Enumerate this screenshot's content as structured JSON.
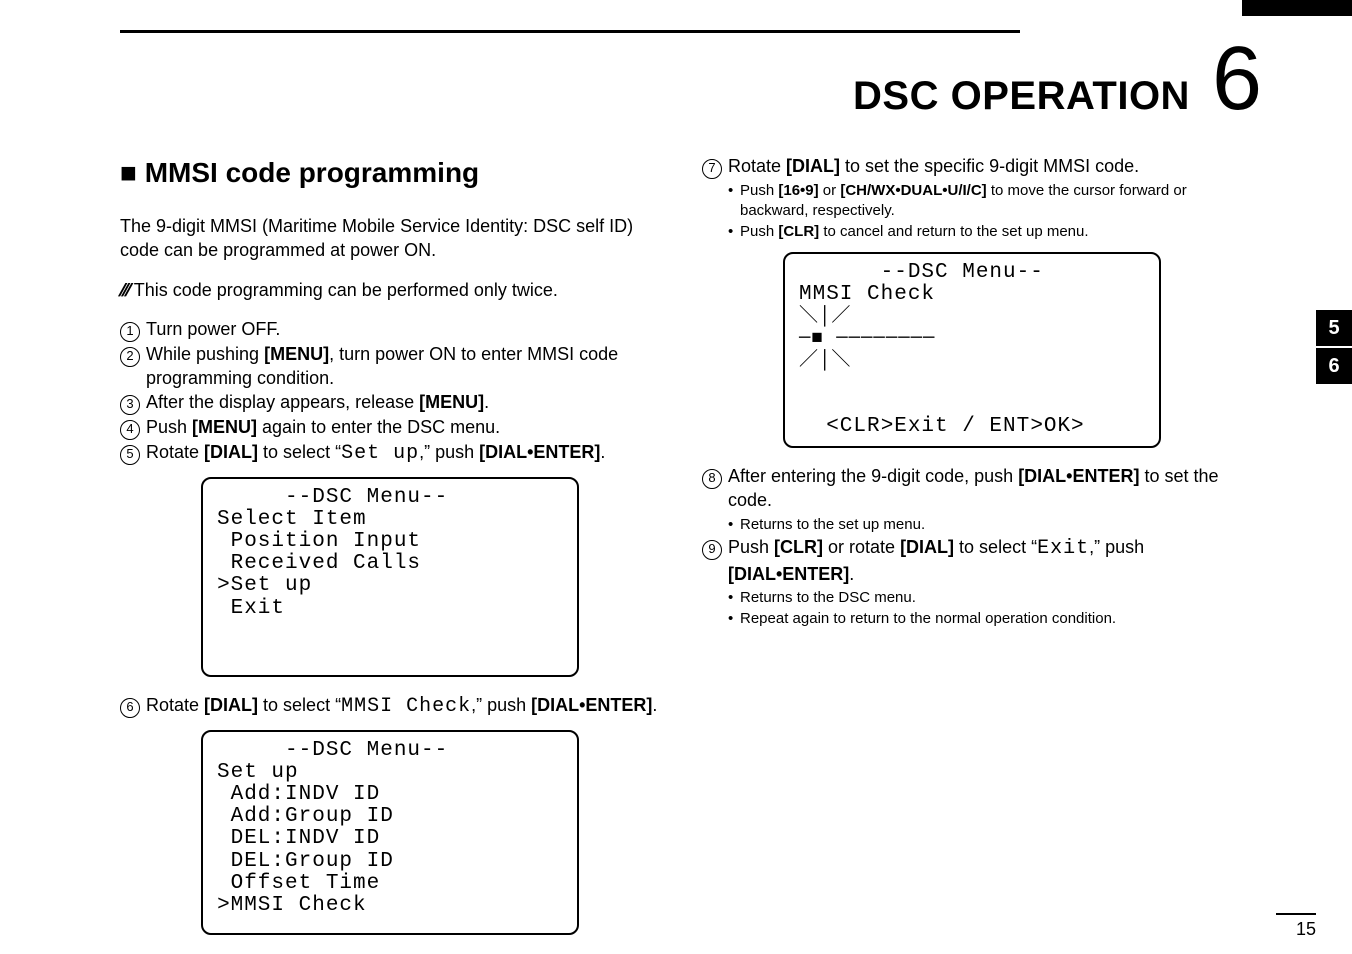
{
  "header": {
    "title": "DSC OPERATION",
    "chapter_number": "6"
  },
  "section_title": "■ MMSI code programming",
  "intro": "The 9-digit MMSI (Maritime Mobile Service Identity: DSC self ID) code can be programmed at power ON.",
  "note": "This code programming can be performed only twice.",
  "steps": {
    "s1": "Turn power OFF.",
    "s2_a": "While pushing ",
    "s2_menu": "[MENU]",
    "s2_b": ", turn power ON to enter MMSI code programming condition.",
    "s3_a": "After the display appears, release ",
    "s3_menu": "[MENU]",
    "s3_dot": ".",
    "s4_a": "Push ",
    "s4_menu": "[MENU]",
    "s4_b": " again to enter the DSC menu.",
    "s5_a": "Rotate ",
    "s5_dial": "[DIAL]",
    "s5_b": " to select “",
    "s5_item": "Set up",
    "s5_c": ",” push ",
    "s5_de": "[DIAL•ENTER]",
    "s5_dot": ".",
    "s6_a": "Rotate ",
    "s6_dial": "[DIAL]",
    "s6_b": " to select “",
    "s6_item": "MMSI  Check",
    "s6_c": ",” push ",
    "s6_de": "[DIAL•ENTER]",
    "s6_dot": ".",
    "s7_a": "Rotate ",
    "s7_dial": "[DIAL]",
    "s7_b": " to set the specific 9-digit MMSI code.",
    "s7_bullet1_a": "Push ",
    "s7_bullet1_b1": "[16•9]",
    "s7_bullet1_or": " or ",
    "s7_bullet1_b2": "[CH/WX•DUAL•U/I/C]",
    "s7_bullet1_c": " to move the cursor forward or backward, respectively.",
    "s7_bullet2_a": "Push ",
    "s7_bullet2_b": "[CLR]",
    "s7_bullet2_c": " to cancel and return to the set up menu.",
    "s8_a": "After entering the 9-digit code, push ",
    "s8_de": "[DIAL•ENTER]",
    "s8_b": " to set the code.",
    "s8_bullet": "Returns to the set up menu.",
    "s9_a": "Push ",
    "s9_clr": "[CLR]",
    "s9_b": " or rotate ",
    "s9_dial": "[DIAL]",
    "s9_c": " to select “",
    "s9_item": "Exit",
    "s9_d": ",” push ",
    "s9_de": "[DIAL•ENTER]",
    "s9_dot": ".",
    "s9_bullet1": "Returns to the DSC menu.",
    "s9_bullet2": "Repeat again to return to the normal operation condition."
  },
  "lcd1": "     --DSC Menu--\nSelect Item\n Position Input\n Received Calls\n˃Set up\n Exit\n\n",
  "lcd2": "     --DSC Menu--\nSet up\n Add:INDV ID\n Add:Group ID\n DEL:INDV ID\n DEL:Group ID\n Offset Time\n˃MMSI Check",
  "lcd3_top": "      --DSC Menu--\nMMSI Check",
  "lcd3_cursor": "＼│／\n─■ ────────\n／│＼",
  "lcd3_bottom": "  <CLR˃Exit / ENT˃OK>",
  "tabs": {
    "a": "5",
    "b": "6"
  },
  "page_number": "15"
}
